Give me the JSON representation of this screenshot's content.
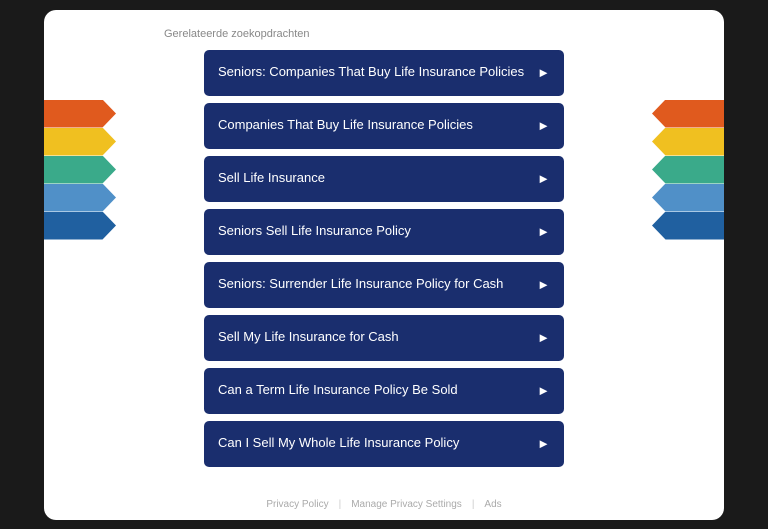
{
  "section": {
    "label": "Gerelateerde zoekopdrachten"
  },
  "buttons": [
    {
      "id": "btn-1",
      "text": "Seniors: Companies That Buy Life Insurance Policies"
    },
    {
      "id": "btn-2",
      "text": "Companies That Buy Life Insurance Policies"
    },
    {
      "id": "btn-3",
      "text": "Sell Life Insurance"
    },
    {
      "id": "btn-4",
      "text": "Seniors Sell Life Insurance Policy"
    },
    {
      "id": "btn-5",
      "text": "Seniors: Surrender Life Insurance Policy for Cash"
    },
    {
      "id": "btn-6",
      "text": "Sell My Life Insurance for Cash"
    },
    {
      "id": "btn-7",
      "text": "Can a Term Life Insurance Policy Be Sold"
    },
    {
      "id": "btn-8",
      "text": "Can I Sell My Whole Life Insurance Policy"
    }
  ],
  "footer": {
    "privacy": "Privacy Policy",
    "manage": "Manage Privacy Settings",
    "ads": "Ads"
  },
  "ribbons": [
    {
      "color": "orange",
      "label": "orange-ribbon"
    },
    {
      "color": "yellow",
      "label": "yellow-ribbon"
    },
    {
      "color": "teal",
      "label": "teal-ribbon"
    },
    {
      "color": "blue",
      "label": "blue-ribbon"
    },
    {
      "color": "dark-blue",
      "label": "dark-blue-ribbon"
    }
  ],
  "arrow": "►"
}
